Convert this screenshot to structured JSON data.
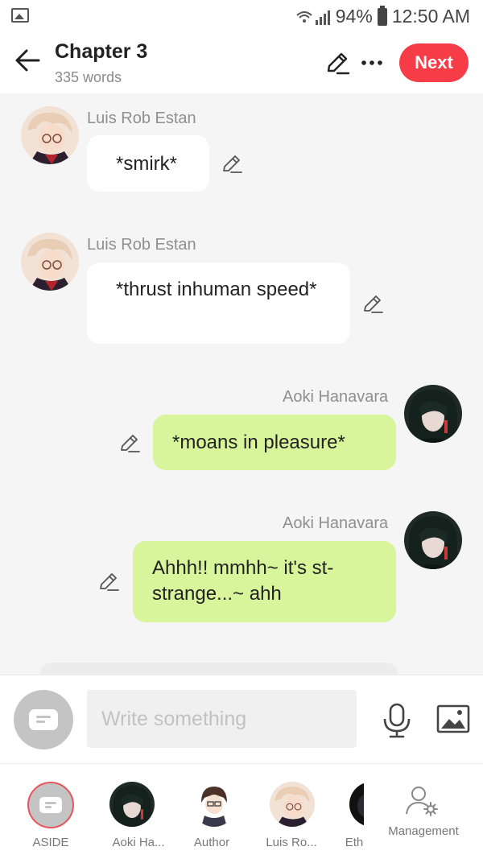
{
  "status": {
    "battery": "94%",
    "time": "12:50 AM"
  },
  "header": {
    "title": "Chapter 3",
    "word_count": "335 words",
    "next_label": "Next"
  },
  "messages": [
    {
      "sender": "Luis Rob Estan",
      "text": "*smirk*",
      "side": "left",
      "style": "white"
    },
    {
      "sender": "Luis Rob Estan",
      "text": "*thrust inhuman speed*",
      "side": "left",
      "style": "white"
    },
    {
      "sender": "Aoki Hanavara",
      "text": "*moans in pleasure*",
      "side": "right",
      "style": "green"
    },
    {
      "sender": "Aoki Hanavara",
      "text": "Ahhh!! mmhh~ it's st-strange...~ ahh",
      "side": "right",
      "style": "green"
    }
  ],
  "composer": {
    "placeholder": "Write something"
  },
  "tabs": [
    {
      "label": "ASIDE"
    },
    {
      "label": "Aoki Ha..."
    },
    {
      "label": "Author"
    },
    {
      "label": "Luis Ro..."
    },
    {
      "label": "Eth"
    },
    {
      "label": "Management"
    }
  ],
  "colors": {
    "accent": "#f53c47",
    "bubble_green": "#d8f59b",
    "bubble_white": "#ffffff",
    "background": "#f5f5f5"
  },
  "icons": [
    "image-icon",
    "wifi-icon",
    "signal-icon",
    "battery-icon",
    "back-arrow-icon",
    "pencil-icon",
    "more-dots-icon",
    "aside-icon",
    "microphone-icon",
    "photo-icon",
    "management-icon"
  ]
}
